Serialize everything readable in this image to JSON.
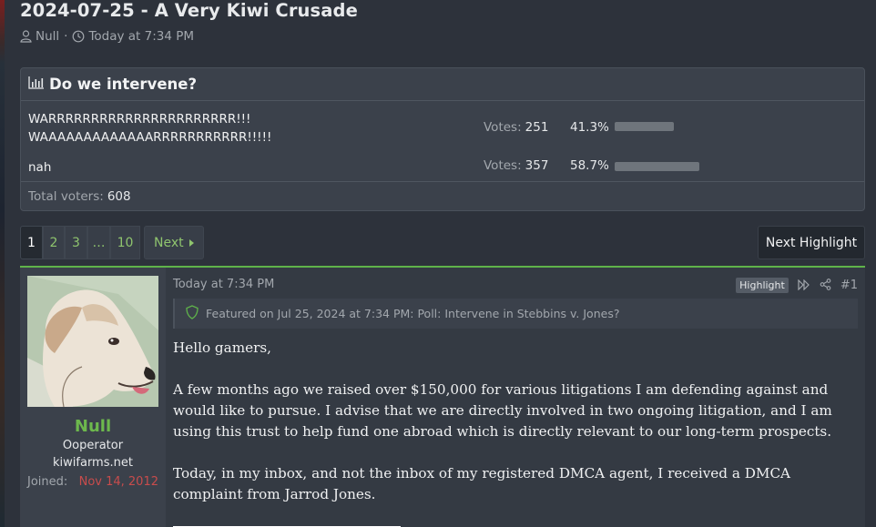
{
  "thread": {
    "title": "2024-07-25 - A Very Kiwi Crusade",
    "author": "Null",
    "separator": "·",
    "time": "Today at 7:34 PM"
  },
  "poll": {
    "question": "Do we intervene?",
    "votes_label": "Votes:",
    "options": [
      {
        "line1": "WARRRRRRRRRRRRRRRRRRRRRR!!!",
        "line2": "WAAAAAAAAAAAAARRRRRRRRRRR!!!!!",
        "votes": "251",
        "percent": "41.3%",
        "share": 0.413
      },
      {
        "line1": "nah",
        "line2": "",
        "votes": "357",
        "percent": "58.7%",
        "share": 0.587
      }
    ],
    "total_label": "Total voters:",
    "total": "608"
  },
  "pagination": {
    "pages": [
      "1",
      "2",
      "3",
      "…",
      "10"
    ],
    "current": "1",
    "next_label": "Next",
    "next_highlight": "Next Highlight"
  },
  "post": {
    "time": "Today at 7:34 PM",
    "highlight_badge": "Highlight",
    "number": "#1",
    "featured": "Featured on Jul 25, 2024 at 7:34 PM: Poll: Intervene in Stebbins v. Jones?",
    "paragraphs": [
      "Hello gamers,",
      "A few months ago we raised over $150,000 for various litigations I am defending against and would like to pursue. I advise that we are directly involved in two ongoing litigation, and I am using this trust to help fund one abroad which is directly relevant to our long-term prospects.",
      "Today, in my inbox, and not the inbox of my registered DMCA agent, I received a DMCA complaint from Jarrod Jones."
    ]
  },
  "user": {
    "name": "Null",
    "title": "Ooperator",
    "banner": "kiwifarms.net",
    "joined_label": "Joined:",
    "joined": "Nov 14, 2012"
  },
  "colors": {
    "accent_green": "#6db84d",
    "link_green": "#8fc46e",
    "joined_red": "#c84c4c",
    "background": "#2d323b"
  }
}
